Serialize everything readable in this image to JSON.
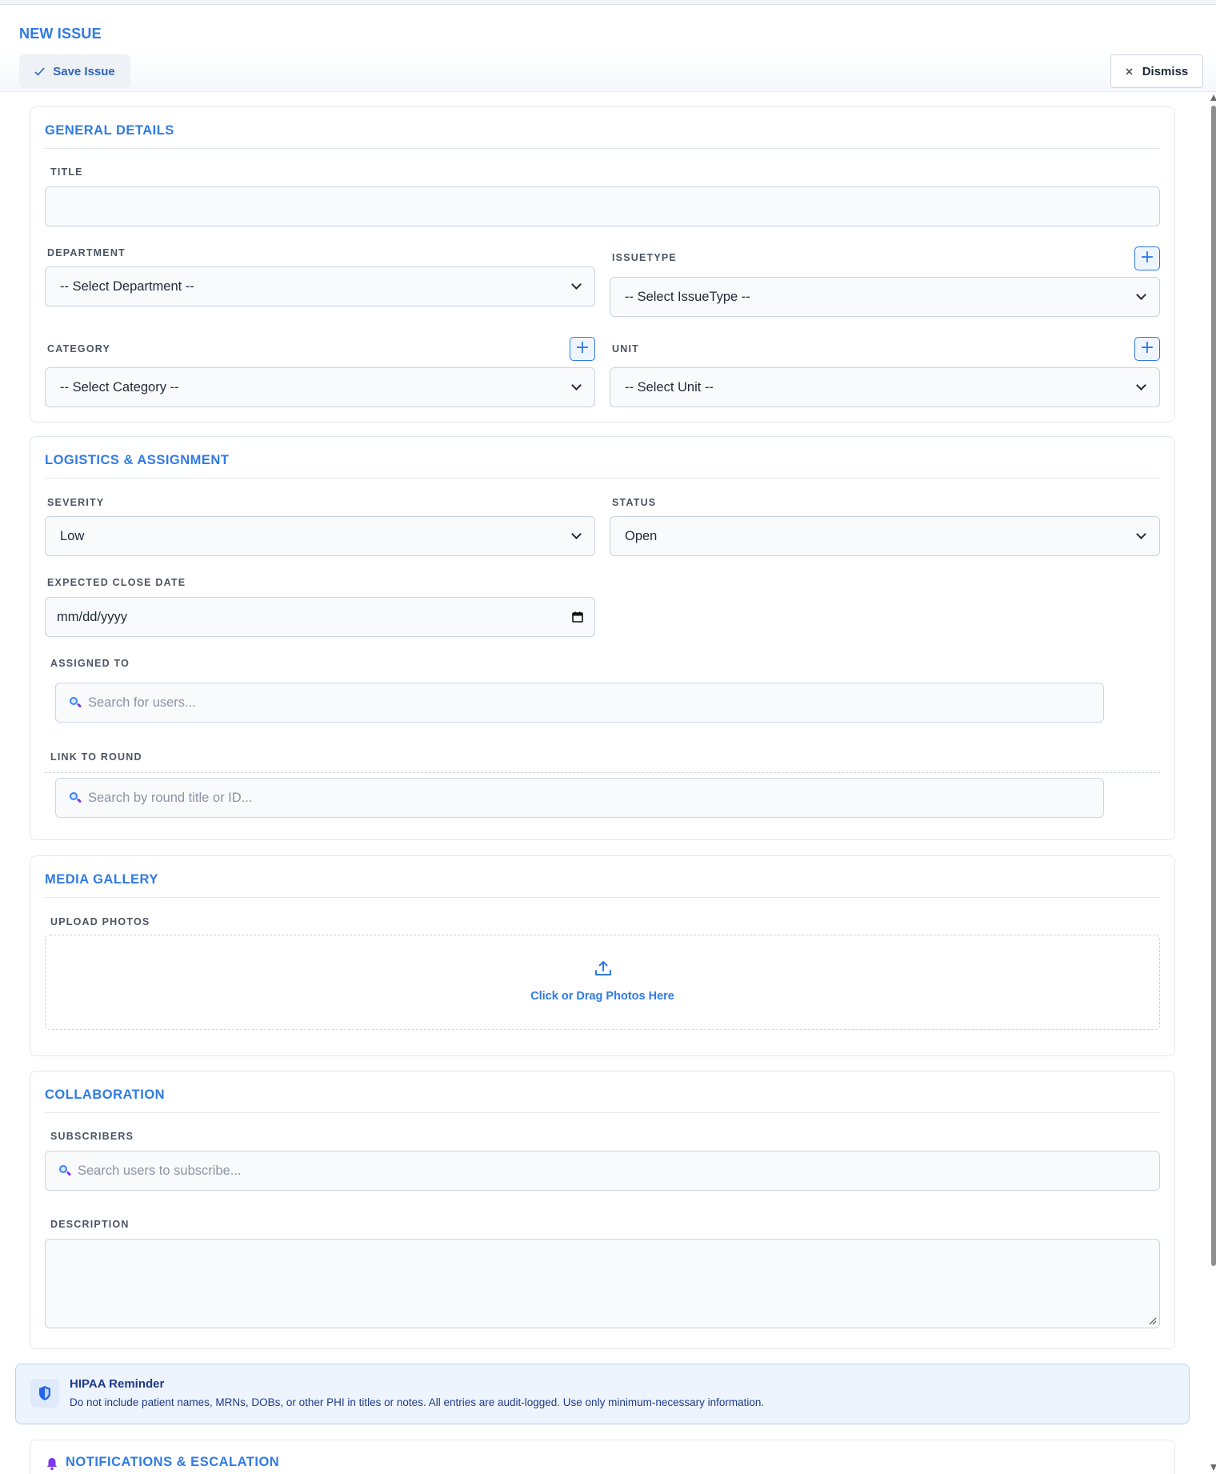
{
  "page": {
    "title": "NEW ISSUE"
  },
  "toolbar": {
    "save_label": "Save Issue",
    "save_icon": "check-icon",
    "dismiss_label": "Dismiss",
    "dismiss_icon": "close-icon"
  },
  "sections": {
    "general": {
      "title": "GENERAL DETAILS",
      "title_label": "TITLE",
      "title_value": "",
      "department_label": "DEPARTMENT",
      "department_value": "-- Select Department --",
      "issuetype_label": "ISSUETYPE",
      "issuetype_value": "-- Select IssueType --",
      "category_label": "CATEGORY",
      "category_value": "-- Select Category --",
      "unit_label": "UNIT",
      "unit_value": "-- Select Unit --",
      "add_symbol": "+"
    },
    "logistics": {
      "title": "LOGISTICS & ASSIGNMENT",
      "severity_label": "SEVERITY",
      "severity_value": "Low",
      "status_label": "STATUS",
      "status_value": "Open",
      "close_date_label": "EXPECTED CLOSE DATE",
      "close_date_placeholder": "mm/dd/yyyy",
      "assigned_label": "ASSIGNED TO",
      "assigned_placeholder": "Search for users...",
      "round_label": "LINK TO ROUND",
      "round_placeholder": "Search by round title or ID..."
    },
    "media": {
      "title": "MEDIA GALLERY",
      "upload_label": "UPLOAD PHOTOS",
      "dropzone_text": "Click or Drag Photos Here",
      "dropzone_icon": "upload-icon"
    },
    "collaboration": {
      "title": "COLLABORATION",
      "subscribers_label": "SUBSCRIBERS",
      "subscribers_placeholder": "Search users to subscribe...",
      "description_label": "DESCRIPTION",
      "description_value": ""
    }
  },
  "hipaa": {
    "icon": "shield-icon",
    "title": "HIPAA Reminder",
    "text": "Do not include patient names, MRNs, DOBs, or other PHI in titles or notes. All entries are audit-logged. Use only minimum-necessary information."
  },
  "notifications": {
    "title": "NOTIFICATIONS & ESCALATION",
    "icon": "bell-icon"
  },
  "colors": {
    "accent": "#2f7ae5",
    "field_bg": "#f8fafc",
    "border": "#c9d3de",
    "hipaa_bg": "#eef4fd",
    "bell": "#7c3aed"
  }
}
